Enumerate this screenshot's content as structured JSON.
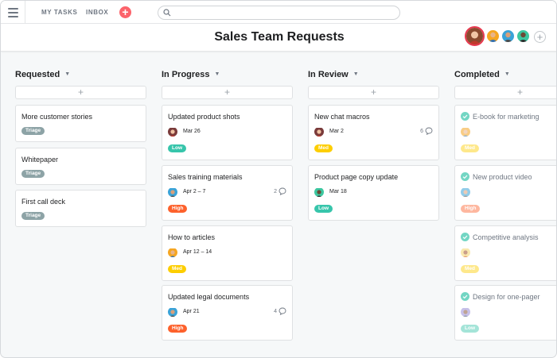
{
  "topbar": {
    "my_tasks": "MY TASKS",
    "inbox": "INBOX",
    "add_symbol": "+",
    "search_placeholder": ""
  },
  "header": {
    "title": "Sales Team Requests",
    "add_member_symbol": "+"
  },
  "colors": {
    "triage": "#8da3a6",
    "low": "#37c5ab",
    "med": "#fdce00",
    "high": "#fd612c",
    "accent": "#fc636b"
  },
  "columns": [
    {
      "title": "Requested",
      "add_symbol": "+",
      "cards": [
        {
          "title": "More customer stories",
          "tag": "Triage"
        },
        {
          "title": "Whitepaper",
          "tag": "Triage"
        },
        {
          "title": "First call deck",
          "tag": "Triage"
        }
      ]
    },
    {
      "title": "In Progress",
      "add_symbol": "+",
      "cards": [
        {
          "title": "Updated product shots",
          "date": "Mar 26",
          "tag": "Low"
        },
        {
          "title": "Sales training materials",
          "date": "Apr 2 – 7",
          "comments": "2",
          "tag": "High"
        },
        {
          "title": "How to articles",
          "date": "Apr 12 – 14",
          "tag": "Med"
        },
        {
          "title": "Updated legal documents",
          "date": "Apr 21",
          "comments": "4",
          "tag": "High"
        }
      ]
    },
    {
      "title": "In Review",
      "add_symbol": "+",
      "cards": [
        {
          "title": "New chat macros",
          "date": "Mar 2",
          "comments": "6",
          "tag": "Med"
        },
        {
          "title": "Product page copy update",
          "date": "Mar 18",
          "tag": "Low"
        }
      ]
    },
    {
      "title": "Completed",
      "add_symbol": "+",
      "cards": [
        {
          "title": "E-book for marketing",
          "tag": "Med"
        },
        {
          "title": "New product video",
          "tag": "High"
        },
        {
          "title": "Competitive analysis",
          "tag": "Med"
        },
        {
          "title": "Design for one-pager",
          "tag": "Low"
        }
      ]
    }
  ]
}
